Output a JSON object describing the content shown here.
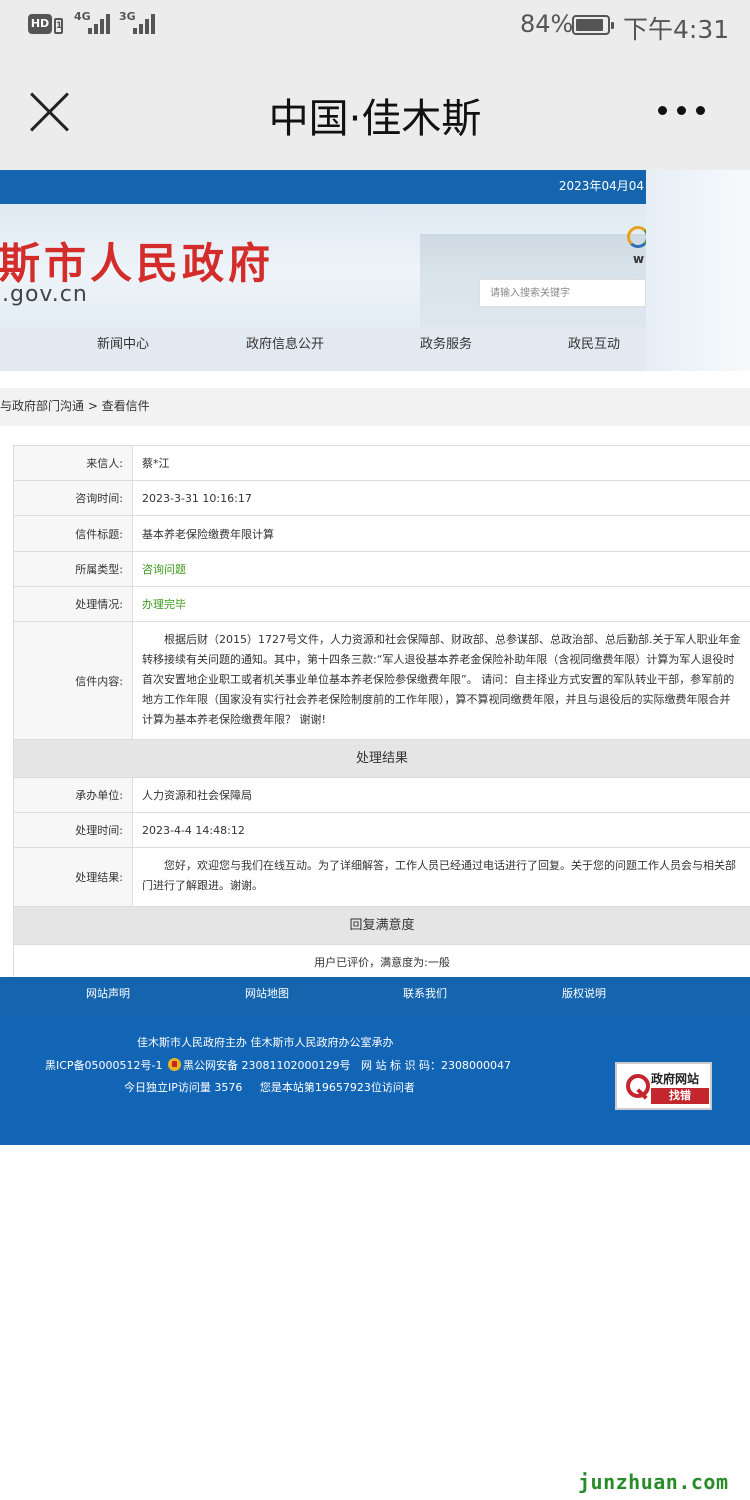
{
  "status_bar": {
    "hd": "HD",
    "sim1_type": "4G",
    "sim2_type": "3G",
    "battery_pct": "84%",
    "time": "下午4:31"
  },
  "app_bar": {
    "title": "中国·佳木斯"
  },
  "site_header": {
    "date": "2023年04月04",
    "site_name": "斯市人民政府",
    "domain": ".gov.cn",
    "emblem_letter": "w",
    "search_placeholder": "请输入搜索关键字",
    "nav": [
      "新闻中心",
      "政府信息公开",
      "政务服务",
      "政民互动"
    ]
  },
  "breadcrumb": "与政府部门沟通 > 查看信件",
  "letter": {
    "sender_label": "来信人:",
    "sender": "蔡*江",
    "time_label": "咨询时间:",
    "time": "2023-3-31 10:16:17",
    "title_label": "信件标题:",
    "title": "基本养老保险缴费年限计算",
    "type_label": "所属类型:",
    "type": "咨询问题",
    "status_label": "处理情况:",
    "status": "办理完毕",
    "content_label": "信件内容:",
    "content": "根据后财（2015）1727号文件，人力资源和社会保障部、财政部、总参谋部、总政治部、总后勤部.关于军人职业年金转移接续有关问题的通知。其中，第十四条三款:“军人退役基本养老金保险补助年限（含视同缴费年限）计算为军人退役时首次安置地企业职工或者机关事业单位基本养老保险参保缴费年限”。 请问：自主择业方式安置的军队转业干部，参军前的地方工作年限（国家没有实行社会养老保险制度前的工作年限），算不算视同缴费年限，并且与退役后的实际缴费年限合并计算为基本养老保险缴费年限？ 谢谢!"
  },
  "result": {
    "section_title": "处理结果",
    "unit_label": "承办单位:",
    "unit": "人力资源和社会保障局",
    "time_label": "处理时间:",
    "time": "2023-4-4 14:48:12",
    "result_label": "处理结果:",
    "result_text": "您好，欢迎您与我们在线互动。为了详细解答，工作人员已经通过电话进行了回复。关于您的问题工作人员会与相关部门进行了解跟进。谢谢。"
  },
  "satisfaction": {
    "section_title": "回复满意度",
    "text": "用户已评价，满意度为:一般"
  },
  "footer": {
    "links": [
      "网站声明",
      "网站地图",
      "联系我们",
      "版权说明"
    ],
    "sponsor": "佳木斯市人民政府主办 佳木斯市人民政府办公室承办",
    "icp": "黑ICP备05000512号-1",
    "police": "黑公网安备 23081102000129号",
    "site_id": "网 站 标 识 码：2308000047",
    "ip_count": "今日独立IP访问量 3576",
    "visitor": "您是本站第19657923位访问者",
    "badge_line1": "政府网站",
    "badge_line2": "找错"
  },
  "watermark": "junzhuan.com"
}
